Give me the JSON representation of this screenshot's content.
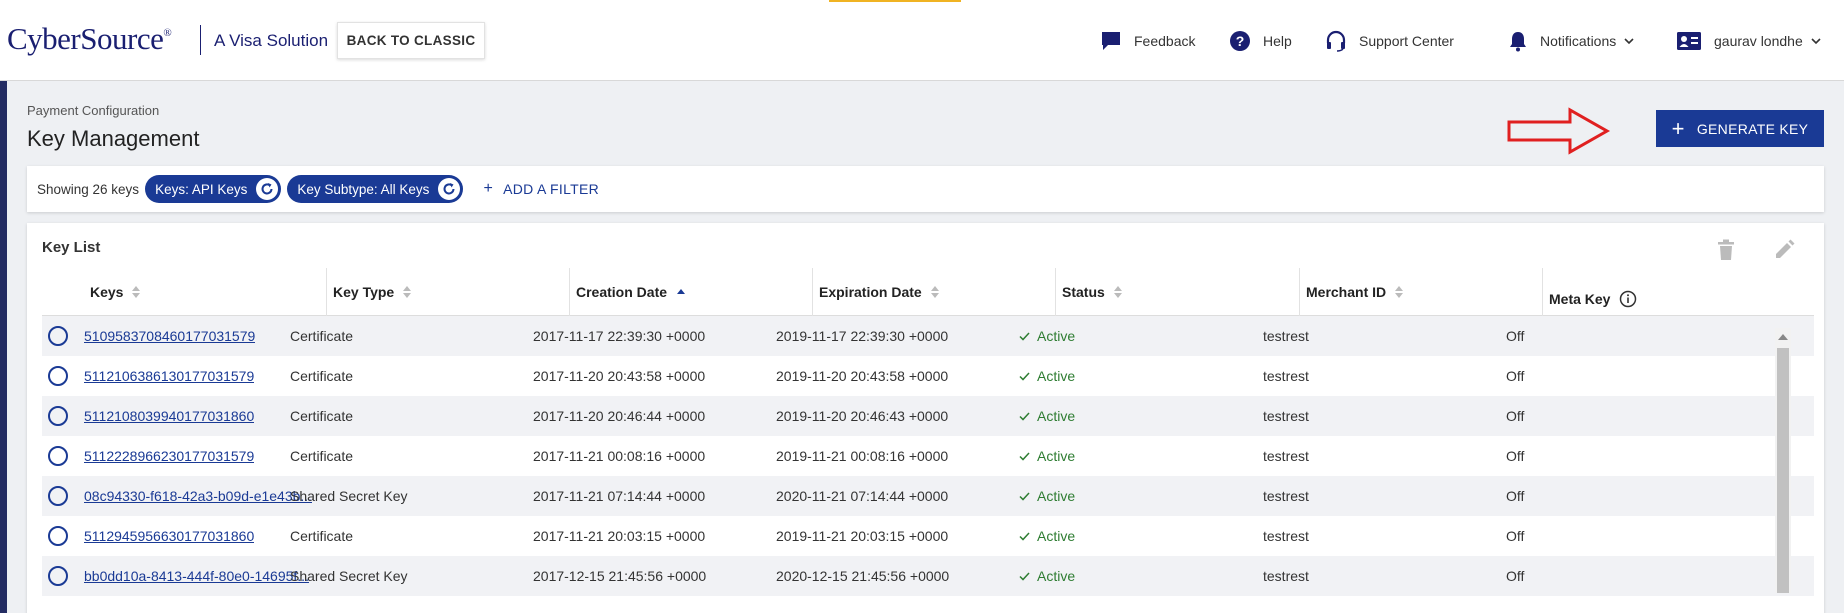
{
  "header": {
    "logo": "CyberSource",
    "logo_mark": "®",
    "logo_sub": "A Visa Solution",
    "back_button": "BACK TO CLASSIC",
    "nav": {
      "feedback": "Feedback",
      "help": "Help",
      "support": "Support Center",
      "notifications": "Notifications",
      "user": "gaurav londhe"
    }
  },
  "page": {
    "breadcrumb": "Payment Configuration",
    "title": "Key Management",
    "generate_button": "GENERATE KEY"
  },
  "filters": {
    "count_text": "Showing 26 keys",
    "chips": [
      "Keys: API Keys",
      "Key Subtype: All Keys"
    ],
    "add_filter": "ADD A FILTER"
  },
  "key_list": {
    "title": "Key List",
    "columns": [
      "Keys",
      "Key Type",
      "Creation Date",
      "Expiration Date",
      "Status",
      "Merchant ID",
      "Meta Key"
    ],
    "rows": [
      {
        "key": "5109583708460177031579",
        "type": "Certificate",
        "created": "2017-11-17 22:39:30 +0000",
        "expires": "2019-11-17 22:39:30 +0000",
        "status": "Active",
        "merchant": "testrest",
        "meta": "Off"
      },
      {
        "key": "5112106386130177031579",
        "type": "Certificate",
        "created": "2017-11-20 20:43:58 +0000",
        "expires": "2019-11-20 20:43:58 +0000",
        "status": "Active",
        "merchant": "testrest",
        "meta": "Off"
      },
      {
        "key": "5112108039940177031860",
        "type": "Certificate",
        "created": "2017-11-20 20:46:44 +0000",
        "expires": "2019-11-20 20:46:43 +0000",
        "status": "Active",
        "merchant": "testrest",
        "meta": "Off"
      },
      {
        "key": "5112228966230177031579",
        "type": "Certificate",
        "created": "2017-11-21 00:08:16 +0000",
        "expires": "2019-11-21 00:08:16 +0000",
        "status": "Active",
        "merchant": "testrest",
        "meta": "Off"
      },
      {
        "key": "08c94330-f618-42a3-b09d-e1e43b...",
        "type": "Shared Secret Key",
        "created": "2017-11-21 07:14:44 +0000",
        "expires": "2020-11-21 07:14:44 +0000",
        "status": "Active",
        "merchant": "testrest",
        "meta": "Off"
      },
      {
        "key": "5112945956630177031860",
        "type": "Certificate",
        "created": "2017-11-21 20:03:15 +0000",
        "expires": "2019-11-21 20:03:15 +0000",
        "status": "Active",
        "merchant": "testrest",
        "meta": "Off"
      },
      {
        "key": "bb0dd10a-8413-444f-80e0-14695f...",
        "type": "Shared Secret Key",
        "created": "2017-12-15 21:45:56 +0000",
        "expires": "2020-12-15 21:45:56 +0000",
        "status": "Active",
        "merchant": "testrest",
        "meta": "Off"
      }
    ]
  },
  "colors": {
    "brand": "#1a1f71",
    "primary": "#1a3a95",
    "active_status": "#2e7d32",
    "annotation_arrow": "#e02020"
  }
}
